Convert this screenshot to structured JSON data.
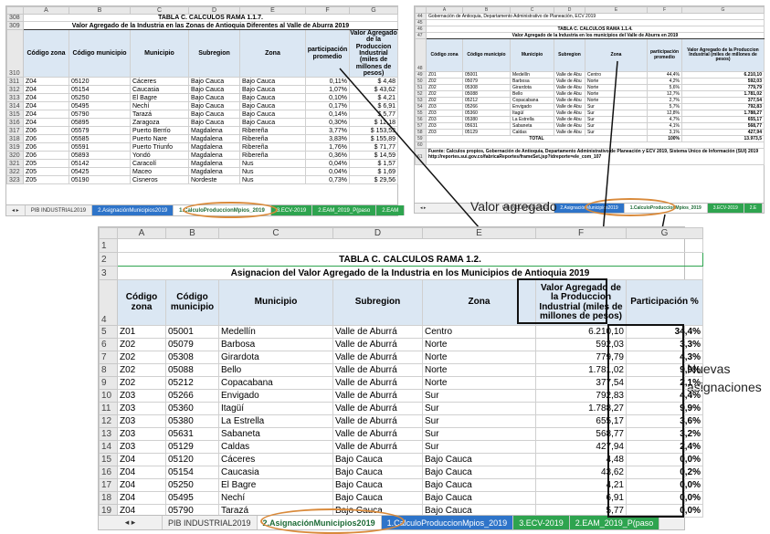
{
  "top_left": {
    "col_letters": [
      "",
      "A",
      "B",
      "C",
      "D",
      "E",
      "F",
      "G"
    ],
    "row308": "TABLA C. CALCULOS RAMA 1.1.7.",
    "row309": "Valor Agregado de la Industria en las Zonas de Antioquia Diferentes al Valle de Aburra 2019",
    "headers": [
      "Código zona",
      "Código municipio",
      "Municipio",
      "Subregion",
      "Zona",
      "participación promedio",
      "Valor Agregado de la Produccion Industrial (miles de millones de pesos)"
    ],
    "rows": [
      {
        "n": "311",
        "zona": "Z04",
        "cod": "05120",
        "mun": "Cáceres",
        "sub": "Bajo Cauca",
        "z": "Bajo Cauca",
        "p": "0,11%",
        "v": "$ 4,48"
      },
      {
        "n": "312",
        "zona": "Z04",
        "cod": "05154",
        "mun": "Caucasia",
        "sub": "Bajo Cauca",
        "z": "Bajo Cauca",
        "p": "1,07%",
        "v": "$ 43,62"
      },
      {
        "n": "313",
        "zona": "Z04",
        "cod": "05250",
        "mun": "El Bagre",
        "sub": "Bajo Cauca",
        "z": "Bajo Cauca",
        "p": "0,10%",
        "v": "$ 4,21"
      },
      {
        "n": "314",
        "zona": "Z04",
        "cod": "05495",
        "mun": "Nechí",
        "sub": "Bajo Cauca",
        "z": "Bajo Cauca",
        "p": "0,17%",
        "v": "$ 6,91"
      },
      {
        "n": "315",
        "zona": "Z04",
        "cod": "05790",
        "mun": "Tarazá",
        "sub": "Bajo Cauca",
        "z": "Bajo Cauca",
        "p": "0,14%",
        "v": "$ 5,77"
      },
      {
        "n": "316",
        "zona": "Z04",
        "cod": "05895",
        "mun": "Zaragoza",
        "sub": "Bajo Cauca",
        "z": "Bajo Cauca",
        "p": "0,30%",
        "v": "$ 12,18"
      },
      {
        "n": "317",
        "zona": "Z06",
        "cod": "05579",
        "mun": "Puerto Berrío",
        "sub": "Magdalena",
        "z": "Ribereña",
        "p": "3,77%",
        "v": "$ 153,53"
      },
      {
        "n": "318",
        "zona": "Z06",
        "cod": "05585",
        "mun": "Puerto Nare",
        "sub": "Magdalena",
        "z": "Ribereña",
        "p": "3,83%",
        "v": "$ 155,89"
      },
      {
        "n": "319",
        "zona": "Z06",
        "cod": "05591",
        "mun": "Puerto Triunfo",
        "sub": "Magdalena",
        "z": "Ribereña",
        "p": "1,76%",
        "v": "$ 71,77"
      },
      {
        "n": "320",
        "zona": "Z06",
        "cod": "05893",
        "mun": "Yondó",
        "sub": "Magdalena",
        "z": "Ribereña",
        "p": "0,36%",
        "v": "$ 14,59"
      },
      {
        "n": "321",
        "zona": "Z05",
        "cod": "05142",
        "mun": "Caracolí",
        "sub": "Magdalena",
        "z": "Nus",
        "p": "0,04%",
        "v": "$ 1,57"
      },
      {
        "n": "322",
        "zona": "Z05",
        "cod": "05425",
        "mun": "Maceo",
        "sub": "Magdalena",
        "z": "Nus",
        "p": "0,04%",
        "v": "$ 1,69"
      },
      {
        "n": "323",
        "zona": "Z05",
        "cod": "05190",
        "mun": "Cisneros",
        "sub": "Nordeste",
        "z": "Nus",
        "p": "0,73%",
        "v": "$ 29,56"
      }
    ],
    "tabs": [
      "PIB INDUSTRIAL2019",
      "2.AsignaciónMunicipios2019",
      "1.CalculoProduccionMpios_2019",
      "3.ECV-2019",
      "2.EAM_2019_P(paso",
      "2.EAM"
    ]
  },
  "top_right": {
    "col_letters": [
      "",
      "A",
      "B",
      "C",
      "D",
      "E",
      "F",
      "G"
    ],
    "row44": "Gobernación de Antioquia, Departamento Administrativo de Planeación, ECV 2019",
    "row46": "TABLA C. CALCULOS RAMA 1.1.4.",
    "row47": "Valor Agregado de la Industria en los municipios del Valle de Aburra en 2019",
    "headers": [
      "Código zona",
      "Código municipio",
      "Municipio",
      "Subregion",
      "Zona",
      "participación promedio",
      "Valor Agregado de la Produccion Industrial (miles de millones de pesos)"
    ],
    "rows": [
      {
        "n": "49",
        "zona": "Z01",
        "cod": "05001",
        "mun": "Medellín",
        "sub": "Valle de Abu",
        "z": "Centro",
        "p": "44,4%",
        "v": "6.210,10"
      },
      {
        "n": "50",
        "zona": "Z02",
        "cod": "05079",
        "mun": "Barbosa",
        "sub": "Valle de Abu",
        "z": "Norte",
        "p": "4,2%",
        "v": "592,03"
      },
      {
        "n": "51",
        "zona": "Z02",
        "cod": "05308",
        "mun": "Girardota",
        "sub": "Valle de Abu",
        "z": "Norte",
        "p": "5,6%",
        "v": "779,79"
      },
      {
        "n": "52",
        "zona": "Z02",
        "cod": "05088",
        "mun": "Bello",
        "sub": "Valle de Abu",
        "z": "Norte",
        "p": "12,7%",
        "v": "1.781,02"
      },
      {
        "n": "53",
        "zona": "Z02",
        "cod": "05212",
        "mun": "Copacabana",
        "sub": "Valle de Abu",
        "z": "Norte",
        "p": "2,7%",
        "v": "377,54"
      },
      {
        "n": "54",
        "zona": "Z03",
        "cod": "05266",
        "mun": "Envigado",
        "sub": "Valle de Abu",
        "z": "Sur",
        "p": "5,7%",
        "v": "792,83"
      },
      {
        "n": "55",
        "zona": "Z03",
        "cod": "05360",
        "mun": "Itagüí",
        "sub": "Valle de Abu",
        "z": "Sur",
        "p": "12,8%",
        "v": "1.788,27"
      },
      {
        "n": "56",
        "zona": "Z03",
        "cod": "05380",
        "mun": "La Estrella",
        "sub": "Valle de Abu",
        "z": "Sur",
        "p": "4,7%",
        "v": "655,17"
      },
      {
        "n": "57",
        "zona": "Z03",
        "cod": "05631",
        "mun": "Sabaneta",
        "sub": "Valle de Abu",
        "z": "Sur",
        "p": "4,1%",
        "v": "568,77"
      },
      {
        "n": "58",
        "zona": "Z03",
        "cod": "05129",
        "mun": "Caldas",
        "sub": "Valle de Abu",
        "z": "Sur",
        "p": "3,1%",
        "v": "427,94"
      }
    ],
    "total_label": "TOTAL",
    "total_p": "100%",
    "total_v": "13.973,5",
    "source": "Fuente: Calculos propios, Gobernación de Antioquia, Departamento Administrativo de Planeación y ECV 2019, Sistema Único de Información (SUI) 2019 http://reportes.sui.gov.co/fabricaReportes/frameSet.jsp?idreporte=ele_com_107",
    "tabs": [
      "PIB INDUSTRIAL2019",
      "2.AsignaciónMunicipios2019",
      "1.CalculoProduccionMpios_2019",
      "3.ECV-2019",
      "2.E"
    ]
  },
  "annotations": {
    "valor_agregado": "Valor agregado",
    "nuevas_asignaciones": "Nuevas asignaciones"
  },
  "bottom": {
    "col_letters": [
      "",
      "A",
      "B",
      "C",
      "D",
      "E",
      "F",
      "G"
    ],
    "title1": "TABLA C. CALCULOS RAMA 1.2.",
    "title2": "Asignacion del Valor Agregado de la Industria en los Municipios de Antioquia 2019",
    "headers": [
      "Código zona",
      "Código municipio",
      "Municipio",
      "Subregion",
      "Zona",
      "Valor Agregado de la Produccion Industrial (miles de millones de pesos)",
      "Participación %"
    ],
    "rows": [
      {
        "n": "5",
        "zona": "Z01",
        "cod": "05001",
        "mun": "Medellín",
        "sub": "Valle de Aburrá",
        "z": "Centro",
        "v": "6.210,10",
        "p": "34,4%"
      },
      {
        "n": "6",
        "zona": "Z02",
        "cod": "05079",
        "mun": "Barbosa",
        "sub": "Valle de Aburrá",
        "z": "Norte",
        "v": "592,03",
        "p": "3,3%"
      },
      {
        "n": "7",
        "zona": "Z02",
        "cod": "05308",
        "mun": "Girardota",
        "sub": "Valle de Aburrá",
        "z": "Norte",
        "v": "779,79",
        "p": "4,3%"
      },
      {
        "n": "8",
        "zona": "Z02",
        "cod": "05088",
        "mun": "Bello",
        "sub": "Valle de Aburrá",
        "z": "Norte",
        "v": "1.781,02",
        "p": "9,9%"
      },
      {
        "n": "9",
        "zona": "Z02",
        "cod": "05212",
        "mun": "Copacabana",
        "sub": "Valle de Aburrá",
        "z": "Norte",
        "v": "377,54",
        "p": "2,1%"
      },
      {
        "n": "10",
        "zona": "Z03",
        "cod": "05266",
        "mun": "Envigado",
        "sub": "Valle de Aburrá",
        "z": "Sur",
        "v": "792,83",
        "p": "4,4%"
      },
      {
        "n": "11",
        "zona": "Z03",
        "cod": "05360",
        "mun": "Itagüí",
        "sub": "Valle de Aburrá",
        "z": "Sur",
        "v": "1.788,27",
        "p": "9,9%"
      },
      {
        "n": "12",
        "zona": "Z03",
        "cod": "05380",
        "mun": "La Estrella",
        "sub": "Valle de Aburrá",
        "z": "Sur",
        "v": "655,17",
        "p": "3,6%"
      },
      {
        "n": "13",
        "zona": "Z03",
        "cod": "05631",
        "mun": "Sabaneta",
        "sub": "Valle de Aburrá",
        "z": "Sur",
        "v": "568,77",
        "p": "3,2%"
      },
      {
        "n": "14",
        "zona": "Z03",
        "cod": "05129",
        "mun": "Caldas",
        "sub": "Valle de Aburrá",
        "z": "Sur",
        "v": "427,94",
        "p": "2,4%"
      },
      {
        "n": "15",
        "zona": "Z04",
        "cod": "05120",
        "mun": "Cáceres",
        "sub": "Bajo Cauca",
        "z": "Bajo Cauca",
        "v": "4,48",
        "p": "0,0%"
      },
      {
        "n": "16",
        "zona": "Z04",
        "cod": "05154",
        "mun": "Caucasia",
        "sub": "Bajo Cauca",
        "z": "Bajo Cauca",
        "v": "43,62",
        "p": "0,2%"
      },
      {
        "n": "17",
        "zona": "Z04",
        "cod": "05250",
        "mun": "El Bagre",
        "sub": "Bajo Cauca",
        "z": "Bajo Cauca",
        "v": "4,21",
        "p": "0,0%"
      },
      {
        "n": "18",
        "zona": "Z04",
        "cod": "05495",
        "mun": "Nechí",
        "sub": "Bajo Cauca",
        "z": "Bajo Cauca",
        "v": "6,91",
        "p": "0,0%"
      },
      {
        "n": "19",
        "zona": "Z04",
        "cod": "05790",
        "mun": "Tarazá",
        "sub": "Bajo Cauca",
        "z": "Bajo Cauca",
        "v": "5,77",
        "p": "0,0%"
      }
    ],
    "tabs": [
      "PIB INDUSTRIAL2019",
      "2.AsignaciónMunicipios2019",
      "1.CalculoProduccionMpios_2019",
      "3.ECV-2019",
      "2.EAM_2019_P(paso"
    ]
  }
}
